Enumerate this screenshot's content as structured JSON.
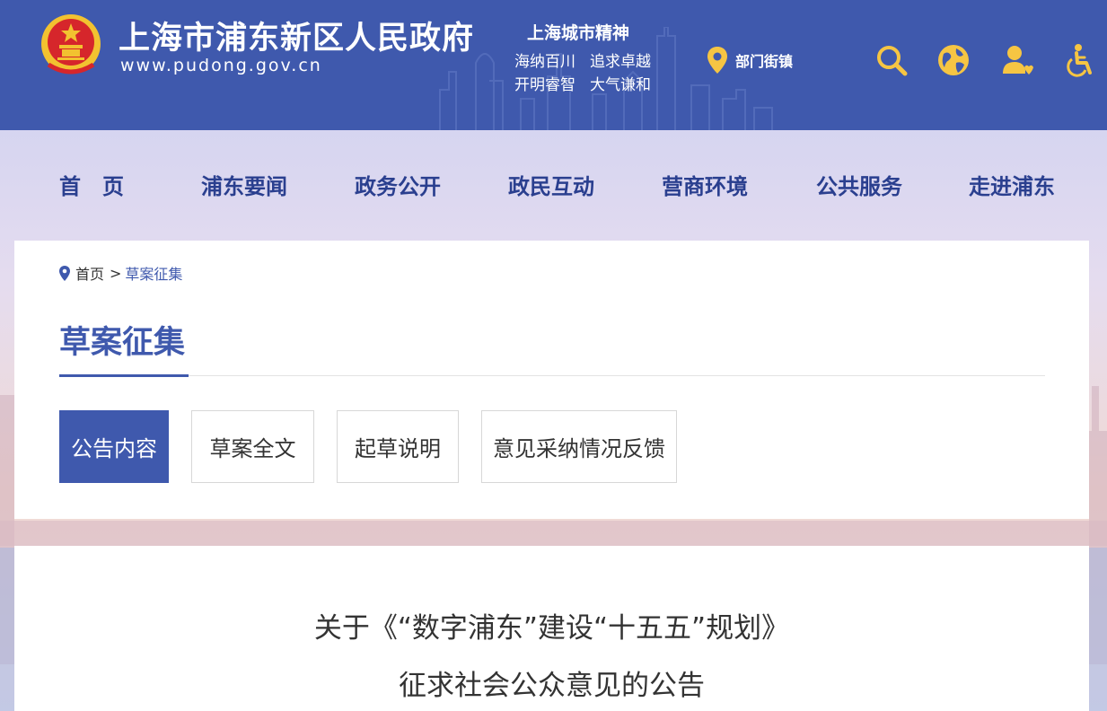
{
  "header": {
    "site_title": "上海市浦东新区人民政府",
    "site_url": "www.pudong.gov.cn",
    "slogan": {
      "title": "上海城市精神",
      "line1a": "海纳百川",
      "line1b": "追求卓越",
      "line2a": "开明睿智",
      "line2b": "大气谦和"
    },
    "dept_label": "部门街镇",
    "icons": [
      "search-icon",
      "globe-icon",
      "user-icon",
      "accessibility-icon"
    ],
    "brand_color": "#3f59ad",
    "icon_color": "#f6c543"
  },
  "nav": {
    "items": [
      "首　页",
      "浦东要闻",
      "政务公开",
      "政民互动",
      "营商环境",
      "公共服务",
      "走进浦东"
    ]
  },
  "breadcrumb": {
    "home": "首页",
    "separator": ">",
    "current": "草案征集"
  },
  "section": {
    "title": "草案征集"
  },
  "tabs": {
    "items": [
      "公告内容",
      "草案全文",
      "起草说明",
      "意见采纳情况反馈"
    ],
    "active_index": 0
  },
  "notice": {
    "line1": "关于《“数字浦东”建设“十五五”规划》",
    "line2": "征求社会公众意见的公告"
  }
}
